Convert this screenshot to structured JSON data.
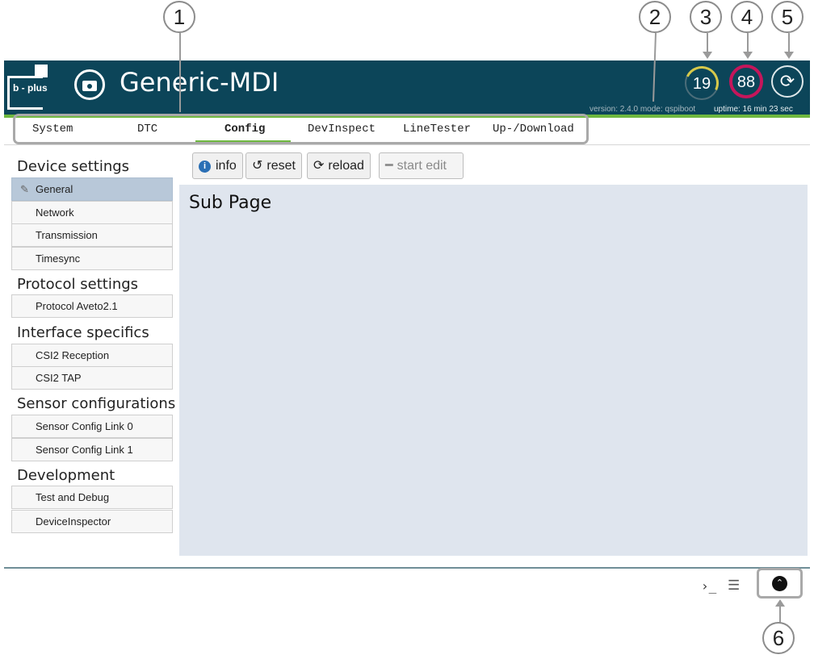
{
  "callouts": [
    "1",
    "2",
    "3",
    "4",
    "5",
    "6"
  ],
  "header": {
    "logo_text": "b - plus",
    "app_title": "Generic-MDI",
    "version": "version: 2.4.0 mode: qspiboot",
    "uptime": "uptime:  16 min 23 sec",
    "gauge_cpu": "19",
    "gauge_mem": "88",
    "refresh_glyph": "⟳",
    "colors": {
      "bar": "#0c4559",
      "accent": "#6fb83f",
      "gauge_cpu": "#d7c94a",
      "gauge_mem": "#c5165b"
    }
  },
  "tabs": [
    {
      "label": "System"
    },
    {
      "label": "DTC"
    },
    {
      "label": "Config",
      "active": true
    },
    {
      "label": "DevInspect"
    },
    {
      "label": "LineTester"
    },
    {
      "label": "Up-/Download"
    }
  ],
  "sidebar": {
    "sections": [
      {
        "title": "Device settings",
        "items": [
          "General",
          "Network",
          "Transmission",
          "Timesync"
        ]
      },
      {
        "title": "Protocol settings",
        "items": [
          "Protocol Aveto2.1"
        ]
      },
      {
        "title": "Interface specifics",
        "items": [
          "CSI2 Reception",
          "CSI2 TAP"
        ]
      },
      {
        "title": "Sensor configurations",
        "items": [
          "Sensor Config Link 0",
          "Sensor Config Link 1"
        ]
      },
      {
        "title": "Development",
        "items": [
          "Test and Debug",
          "DeviceInspector"
        ]
      }
    ],
    "active_item": "General"
  },
  "toolbar": {
    "info": "info",
    "reset": "reset",
    "reload": "reload",
    "start_edit": "start edit"
  },
  "content": {
    "title": "Sub Page"
  },
  "footer": {
    "terminal_glyph": "›_",
    "list_glyph": "☰",
    "up_glyph": "⌃"
  },
  "icons": [
    "camera-icon",
    "refresh-icon",
    "info-icon",
    "reset-icon",
    "reload-icon",
    "minus-icon",
    "pencil-icon",
    "terminal-icon",
    "list-icon",
    "chevron-up-icon"
  ]
}
